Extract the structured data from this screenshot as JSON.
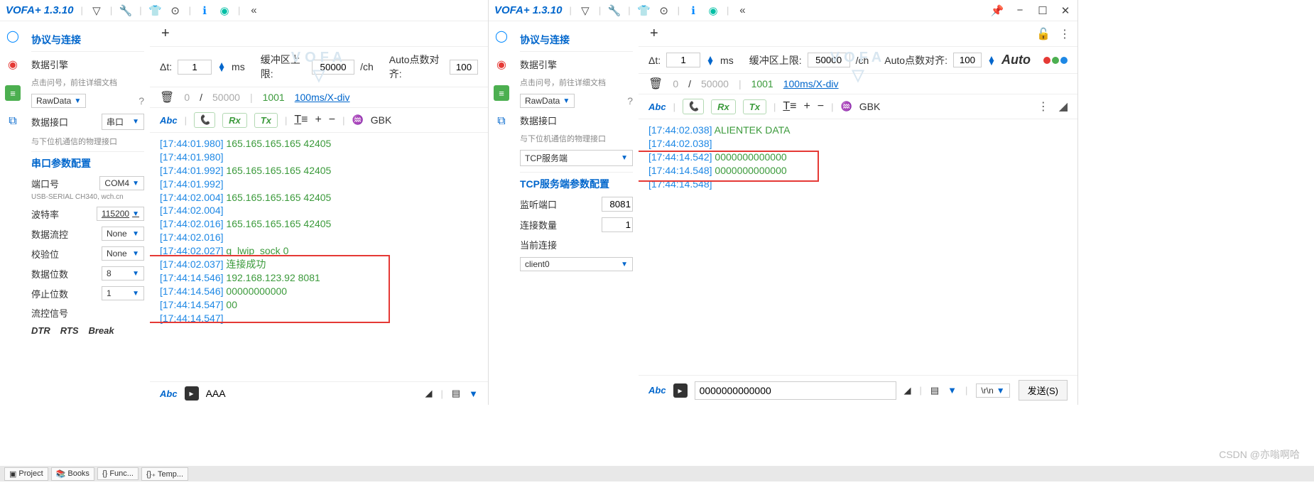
{
  "brand": "VOFA+ 1.3.10",
  "toolbar_icons": [
    "nav-icon",
    "wrench-icon",
    "shirt-icon",
    "target-icon",
    "info-icon",
    "fingerprint-icon",
    "chevron-left-icon"
  ],
  "window_controls": [
    "pin",
    "minimize",
    "maximize",
    "close"
  ],
  "sidebar_icons": [
    "circle-icon",
    "record-icon",
    "menu-icon",
    "copy-icon"
  ],
  "left": {
    "sections": {
      "protocol": "协议与连接",
      "engine": "数据引擎",
      "engine_hint": "点击问号，前往详细文档",
      "engine_value": "RawData",
      "interface": "数据接口",
      "interface_hint": "与下位机通信的物理接口",
      "interface_value": "串口",
      "serial_cfg": "串口参数配置",
      "port_label": "端口号",
      "port_value": "COM4",
      "port_desc": "USB-SERIAL CH340, wch.cn",
      "baud_label": "波特率",
      "baud_value": "115200",
      "flow_label": "数据流控",
      "flow_value": "None",
      "parity_label": "校验位",
      "parity_value": "None",
      "databits_label": "数据位数",
      "databits_value": "8",
      "stopbits_label": "停止位数",
      "stopbits_value": "1",
      "signal_label": "流控信号",
      "sig_dtr": "DTR",
      "sig_rts": "RTS",
      "sig_break": "Break"
    },
    "params": {
      "dt_label": "Δt:",
      "dt_value": "1",
      "dt_unit": "ms",
      "buf_label": "缓冲区上限:",
      "buf_value": "50000",
      "buf_unit": "/ch",
      "auto_label": "Auto点数对齐:",
      "auto_value": "100"
    },
    "status": {
      "cur": "0",
      "max": "50000",
      "idx": "1001",
      "rate": "100ms/X-div"
    },
    "filter": {
      "abc": "Abc",
      "rx": "Rx",
      "tx": "Tx",
      "gbk": "GBK"
    },
    "log": [
      {
        "ts": "[17:44:01.980]",
        "val": "165.165.165.165 42405"
      },
      {
        "ts": "[17:44:01.980]",
        "val": ""
      },
      {
        "ts": "[17:44:01.992]",
        "val": "165.165.165.165 42405"
      },
      {
        "ts": "[17:44:01.992]",
        "val": ""
      },
      {
        "ts": "[17:44:02.004]",
        "val": "165.165.165.165 42405"
      },
      {
        "ts": "[17:44:02.004]",
        "val": ""
      },
      {
        "ts": "[17:44:02.016]",
        "val": "165.165.165.165 42405"
      },
      {
        "ts": "[17:44:02.016]",
        "val": ""
      },
      {
        "ts": "[17:44:02.027]",
        "val": "g_lwip_sock 0"
      },
      {
        "ts": "[17:44:02.037]",
        "val": "连接成功"
      },
      {
        "ts": "[17:44:14.546]",
        "val": "192.168.123.92 8081"
      },
      {
        "ts": "[17:44:14.546]",
        "val": "00000000000"
      },
      {
        "ts": "[17:44:14.547]",
        "val": "00"
      },
      {
        "ts": "[17:44:14.547]",
        "val": ""
      }
    ],
    "input_value": "AAA"
  },
  "right": {
    "sections": {
      "protocol": "协议与连接",
      "engine": "数据引擎",
      "engine_hint": "点击问号，前往详细文档",
      "engine_value": "RawData",
      "interface": "数据接口",
      "interface_hint": "与下位机通信的物理接口",
      "tcp_value": "TCP服务端",
      "tcp_cfg": "TCP服务端参数配置",
      "listen_label": "监听端口",
      "listen_value": "8081",
      "conn_label": "连接数量",
      "conn_value": "1",
      "cur_label": "当前连接",
      "cur_value": "client0"
    },
    "params": {
      "dt_label": "Δt:",
      "dt_value": "1",
      "dt_unit": "ms",
      "buf_label": "缓冲区上限:",
      "buf_value": "50000",
      "buf_unit": "/ch",
      "auto_label": "Auto点数对齐:",
      "auto_value": "100",
      "auto_tag": "Auto"
    },
    "status": {
      "cur": "0",
      "max": "50000",
      "idx": "1001",
      "rate": "100ms/X-div"
    },
    "filter": {
      "abc": "Abc",
      "rx": "Rx",
      "tx": "Tx",
      "gbk": "GBK"
    },
    "log": [
      {
        "ts": "[17:44:02.038]",
        "val": "ALIENTEK DATA"
      },
      {
        "ts": "[17:44:02.038]",
        "val": ""
      },
      {
        "ts": "[17:44:14.542]",
        "val": "0000000000000"
      },
      {
        "ts": "[17:44:14.548]",
        "val": "0000000000000"
      },
      {
        "ts": "[17:44:14.548]",
        "val": ""
      }
    ],
    "input_value": "0000000000000",
    "newline_value": "\\r\\n",
    "send_label": "发送(S)"
  },
  "taskbar": [
    "Project",
    "Books",
    "{} Func...",
    "{}₊ Temp..."
  ],
  "credit": "CSDN @亦嗡啊哈"
}
